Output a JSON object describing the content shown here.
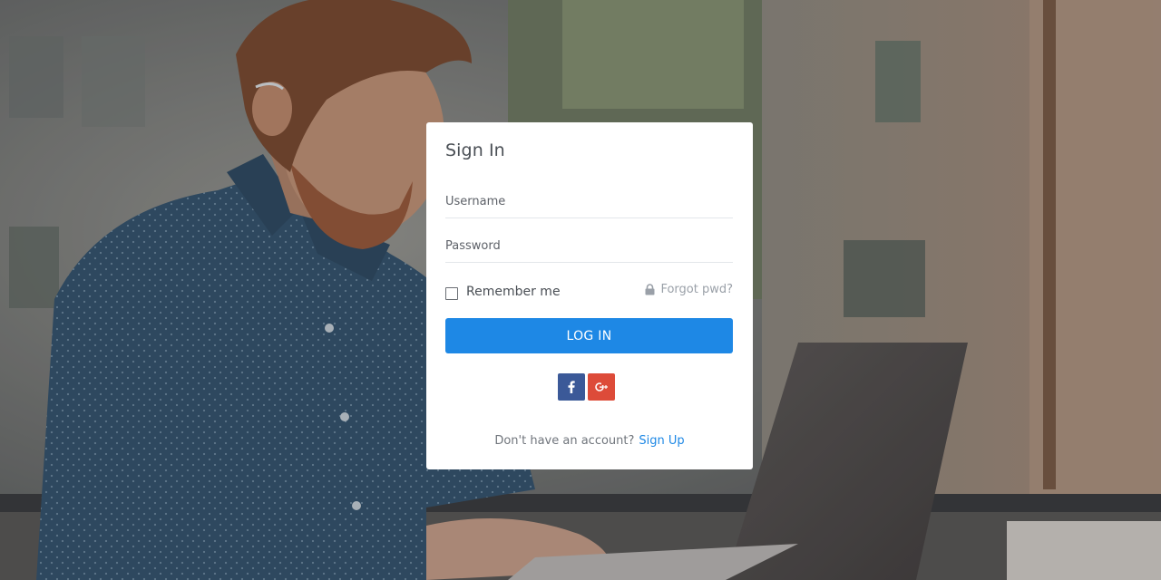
{
  "signin": {
    "title": "Sign In",
    "username_placeholder": "Username",
    "password_placeholder": "Password",
    "remember_label": "Remember me",
    "forgot_label": "Forgot pwd?",
    "login_label": "LOG IN",
    "footer_text": "Don't have an account?",
    "signup_label": "Sign Up"
  },
  "icons": {
    "lock": "lock-icon",
    "facebook": "facebook-icon",
    "google_plus": "google-plus-icon"
  },
  "colors": {
    "primary": "#1e88e5",
    "facebook": "#3b5998",
    "google_plus": "#dd4b39",
    "card": "#ffffff"
  }
}
